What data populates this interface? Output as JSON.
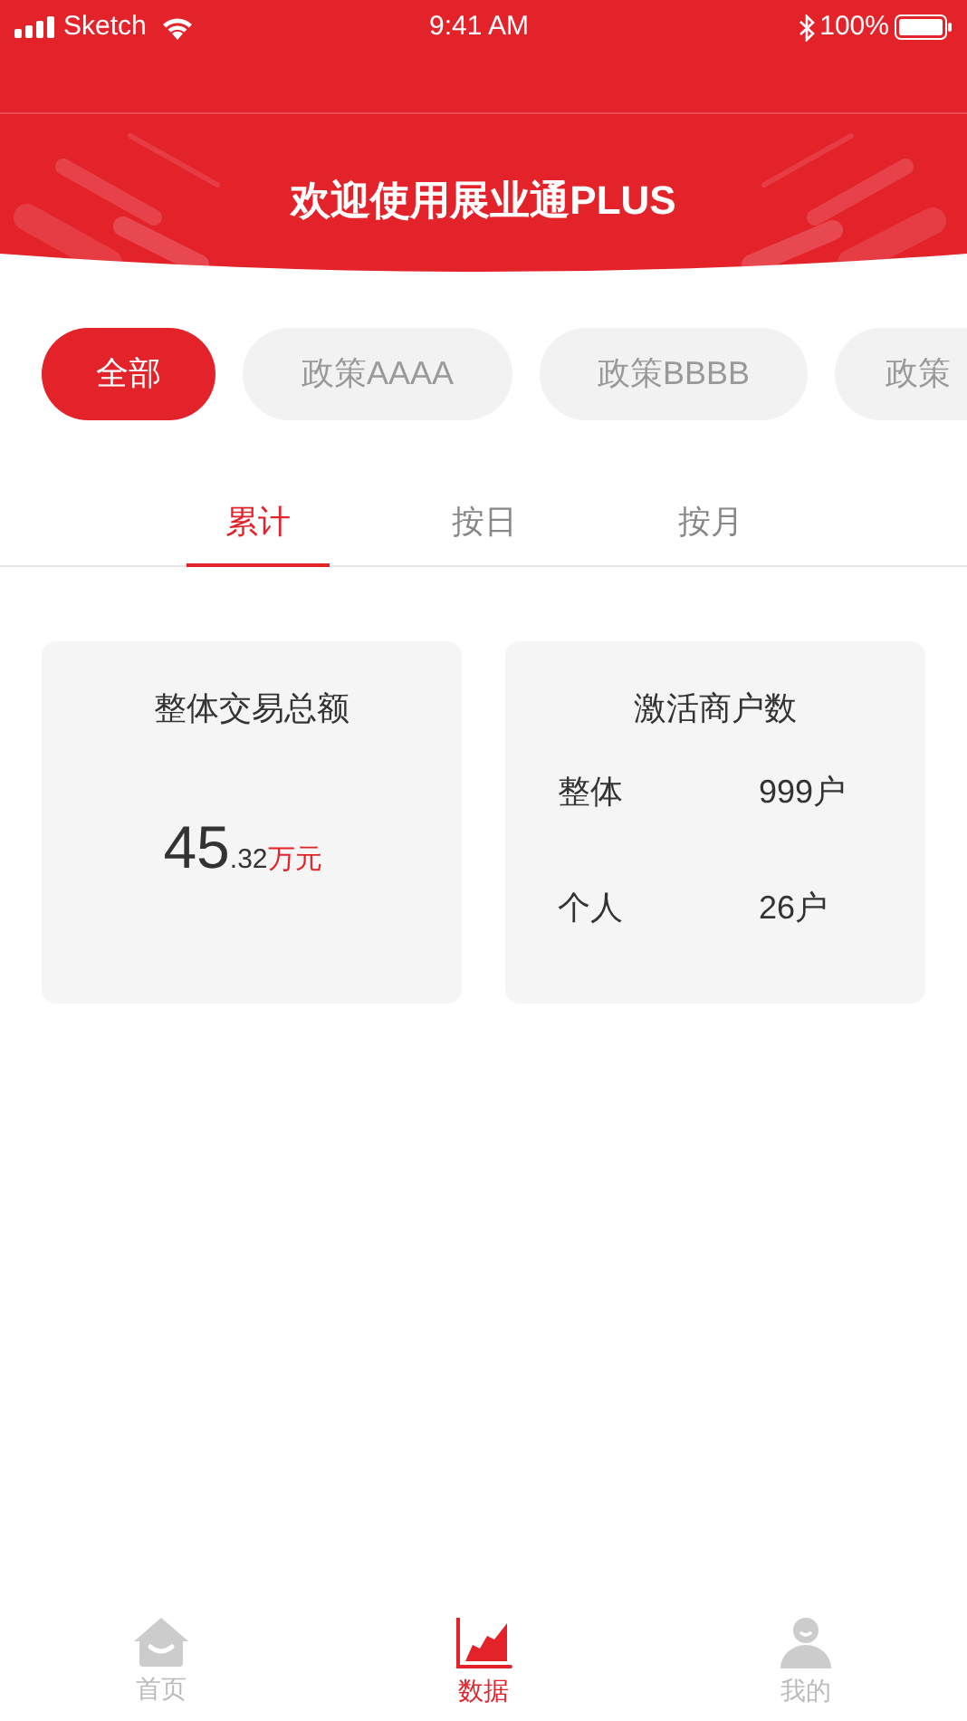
{
  "status_bar": {
    "carrier": "Sketch",
    "time": "9:41 AM",
    "battery": "100%"
  },
  "header": {
    "title": "欢迎使用展业通PLUS"
  },
  "filters": [
    {
      "label": "全部",
      "selected": true
    },
    {
      "label": "政策AAAA",
      "selected": false
    },
    {
      "label": "政策BBBB",
      "selected": false
    },
    {
      "label": "政策",
      "selected": false
    }
  ],
  "tabs": [
    {
      "label": "累计",
      "selected": true
    },
    {
      "label": "按日",
      "selected": false
    },
    {
      "label": "按月",
      "selected": false
    }
  ],
  "cards": [
    {
      "kind": "amount",
      "title": "整体交易总额",
      "integer": "45",
      "decimal": ".32",
      "unit": "万元"
    },
    {
      "kind": "list",
      "title": "激活商户数",
      "rows": [
        {
          "label": "整体",
          "value": "999户"
        },
        {
          "label": "个人",
          "value": "26户"
        }
      ]
    }
  ],
  "tab_bar": [
    {
      "kind": "home",
      "label": "首页",
      "selected": false
    },
    {
      "kind": "chart",
      "label": "数据",
      "selected": true
    },
    {
      "kind": "person",
      "label": "我的",
      "selected": false
    }
  ]
}
